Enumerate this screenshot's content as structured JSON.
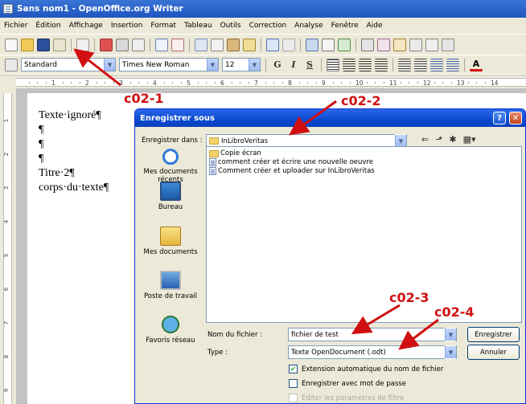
{
  "window": {
    "title": "Sans nom1 - OpenOffice.org Writer"
  },
  "menu": [
    "Fichier",
    "Édition",
    "Affichage",
    "Insertion",
    "Format",
    "Tableau",
    "Outils",
    "Correction",
    "Analyse",
    "Fenêtre",
    "Aide"
  ],
  "formatting": {
    "style": "Standard",
    "font": "Times New Roman",
    "size": "12",
    "bold": "G",
    "italic": "I",
    "underline": "S"
  },
  "ruler": {
    "labels": [
      "1",
      "2",
      "3",
      "4",
      "5",
      "6",
      "7",
      "8",
      "9",
      "10",
      "11",
      "12",
      "13",
      "14"
    ],
    "vlabels": [
      "1",
      "2",
      "3",
      "4",
      "5",
      "6",
      "7",
      "8",
      "9"
    ]
  },
  "document": {
    "lines": [
      "Texte·ignoré¶",
      "¶",
      "¶",
      "¶",
      "Titre·2¶",
      "corps·du·texte¶"
    ]
  },
  "dialog": {
    "title": "Enregistrer sous",
    "save_in_label": "Enregistrer dans :",
    "save_in_value": "InLibroVeritas",
    "places": [
      "Mes documents récents",
      "Bureau",
      "Mes documents",
      "Poste de travail",
      "Favoris réseau"
    ],
    "files": [
      {
        "name": "Copie écran",
        "type": "folder"
      },
      {
        "name": "comment créer et écrire une nouvelle oeuvre",
        "type": "doc"
      },
      {
        "name": "Comment créer et uploader sur InLibroVeritas",
        "type": "doc"
      }
    ],
    "filename_label": "Nom du fichier :",
    "filename_value": "fichier de test",
    "type_label": "Type :",
    "type_value": "Texte OpenDocument (.odt)",
    "save_button": "Enregistrer",
    "cancel_button": "Annuler",
    "checkboxes": [
      {
        "label": "Extension automatique du nom de fichier",
        "checked": true,
        "enabled": true
      },
      {
        "label": "Enregistrer avec mot de passe",
        "checked": false,
        "enabled": true
      },
      {
        "label": "Éditer les paramètres de filtre",
        "checked": false,
        "enabled": false
      }
    ]
  },
  "annotations": {
    "c1": "c02-1",
    "c2": "c02-2",
    "c3": "c02-3",
    "c4": "c02-4"
  },
  "colors": {
    "callout": "#d01010",
    "titlebar": "#1f55c0"
  }
}
